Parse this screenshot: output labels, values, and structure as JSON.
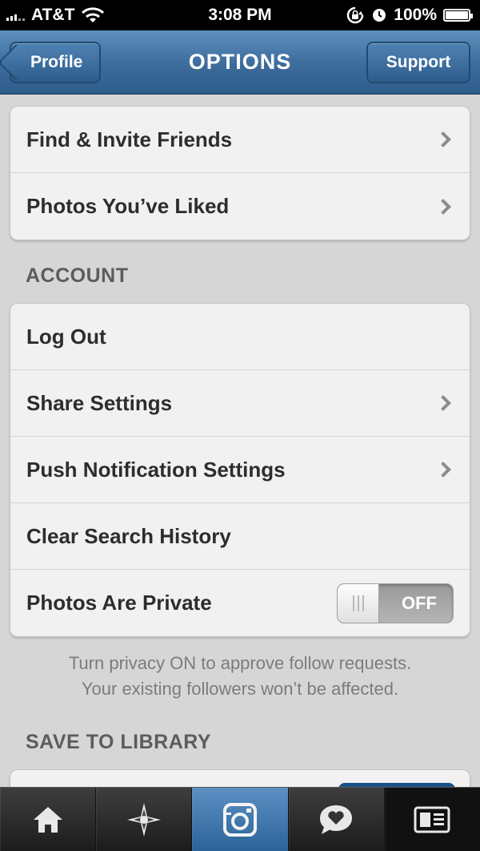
{
  "status_bar": {
    "carrier": "AT&T",
    "time": "3:08 PM",
    "battery": "100%",
    "battery_level": 1.0
  },
  "nav": {
    "back_label": "Profile",
    "title": "OPTIONS",
    "support_label": "Support"
  },
  "group1": {
    "items": [
      {
        "label": "Find & Invite Friends"
      },
      {
        "label": "Photos You’ve Liked"
      }
    ]
  },
  "account": {
    "header": "ACCOUNT",
    "items": [
      {
        "label": "Log Out"
      },
      {
        "label": "Share Settings"
      },
      {
        "label": "Push Notification Settings"
      },
      {
        "label": "Clear Search History"
      },
      {
        "label": "Photos Are Private",
        "toggle_value": "OFF"
      }
    ],
    "note_line1": "Turn privacy ON to approve follow requests.",
    "note_line2": "Your existing followers won’t be affected."
  },
  "save_to_library": {
    "header": "SAVE TO LIBRARY"
  },
  "tab_bar": {
    "tabs": [
      {
        "icon": "home-icon"
      },
      {
        "icon": "explore-icon"
      },
      {
        "icon": "camera-icon"
      },
      {
        "icon": "news-icon"
      },
      {
        "icon": "profile-icon"
      }
    ]
  },
  "colors": {
    "nav_blue": "#3c6c9c",
    "camera_tab_blue": "#4a7fb3"
  }
}
